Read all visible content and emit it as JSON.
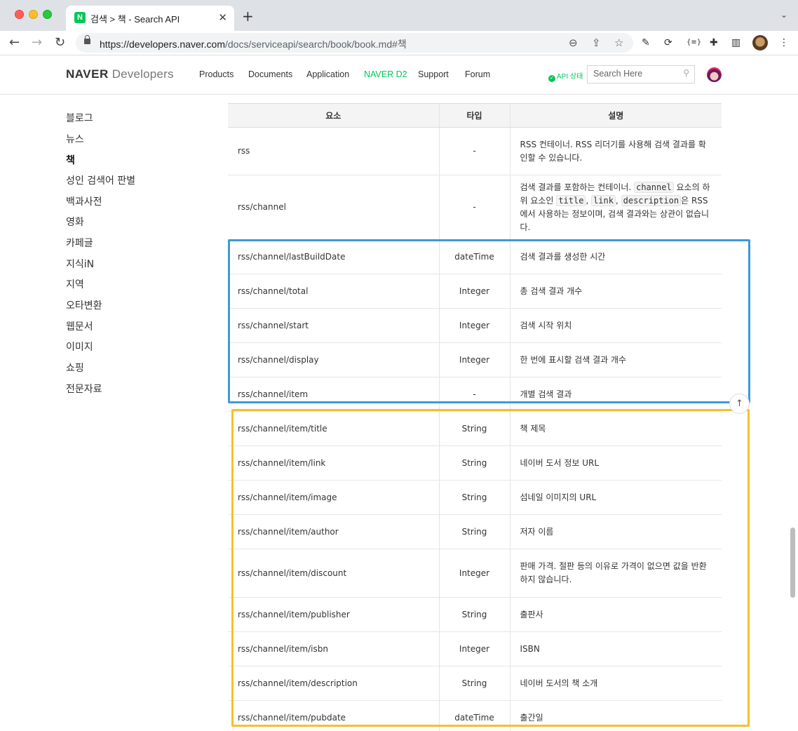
{
  "browser": {
    "tab_title": "검색 > 책 - Search API",
    "tab_favicon": "N",
    "close_glyph": "✕",
    "newtab_glyph": "+",
    "url_host": "https://developers.naver.com",
    "url_path": "/docs/serviceapi/search/book/book.md#책"
  },
  "site": {
    "logo_bold": "NAVER",
    "logo_light": "Developers",
    "nav": [
      "Products",
      "Documents",
      "Application",
      "NAVER D2",
      "Support",
      "Forum"
    ],
    "nav_active": "NAVER D2",
    "api_status": "API 상태",
    "search_placeholder": "Search Here",
    "brand_green": "#03c75a"
  },
  "leftnav": {
    "items": [
      "블로그",
      "뉴스",
      "책",
      "성인 검색어 판별",
      "백과사전",
      "영화",
      "카페글",
      "지식iN",
      "지역",
      "오타변환",
      "웹문서",
      "이미지",
      "쇼핑",
      "전문자료"
    ],
    "active": "책"
  },
  "table": {
    "headers": [
      "요소",
      "타입",
      "설명"
    ],
    "rows": [
      {
        "element": "rss",
        "type": "-",
        "desc": "RSS 컨테이너. RSS 리더기를 사용해 검색 결과를 확인할 수 있습니다."
      },
      {
        "element": "rss/channel",
        "type": "-",
        "desc_pre": "검색 결과를 포함하는 컨테이너.",
        "desc_code1": "channel",
        "desc_mid1": "요소의 하위 요소인",
        "desc_code2": "title",
        "desc_code3": "link",
        "desc_code4": "description",
        "desc_post": "은 RSS에서 사용하는 정보이며, 검색 결과와는 상관이 없습니다."
      },
      {
        "element": "rss/channel/lastBuildDate",
        "type": "dateTime",
        "desc": "검색 결과를 생성한 시간"
      },
      {
        "element": "rss/channel/total",
        "type": "Integer",
        "desc": "총 검색 결과 개수"
      },
      {
        "element": "rss/channel/start",
        "type": "Integer",
        "desc": "검색 시작 위치"
      },
      {
        "element": "rss/channel/display",
        "type": "Integer",
        "desc": "한 번에 표시할 검색 결과 개수"
      },
      {
        "element": "rss/channel/item",
        "type": "-",
        "desc": "개별 검색 결과"
      },
      {
        "element": "rss/channel/item/title",
        "type": "String",
        "desc": "책 제목"
      },
      {
        "element": "rss/channel/item/link",
        "type": "String",
        "desc": "네이버 도서 정보 URL"
      },
      {
        "element": "rss/channel/item/image",
        "type": "String",
        "desc": "섬네일 이미지의 URL"
      },
      {
        "element": "rss/channel/item/author",
        "type": "String",
        "desc": "저자 이름"
      },
      {
        "element": "rss/channel/item/discount",
        "type": "Integer",
        "desc": "판매 가격. 절판 등의 이유로 가격이 없으면 값을 반환하지 않습니다."
      },
      {
        "element": "rss/channel/item/publisher",
        "type": "String",
        "desc": "출판사"
      },
      {
        "element": "rss/channel/item/isbn",
        "type": "Integer",
        "desc": "ISBN"
      },
      {
        "element": "rss/channel/item/description",
        "type": "String",
        "desc": "네이버 도서의 책 소개"
      },
      {
        "element": "rss/channel/item/pubdate",
        "type": "dateTime",
        "desc": "출간일"
      }
    ]
  },
  "annotations": {
    "blue": "#3d9bd6",
    "yellow": "#f2c12e"
  },
  "top_button_glyph": "↑"
}
